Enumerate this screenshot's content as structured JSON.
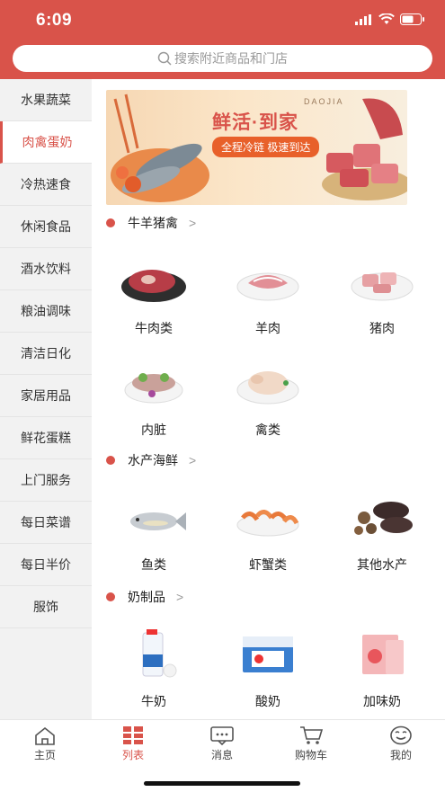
{
  "status": {
    "time": "6:09"
  },
  "search": {
    "placeholder": "搜索附近商品和门店"
  },
  "sidebar": {
    "items": [
      {
        "label": "水果蔬菜"
      },
      {
        "label": "肉禽蛋奶"
      },
      {
        "label": "冷热速食"
      },
      {
        "label": "休闲食品"
      },
      {
        "label": "酒水饮料"
      },
      {
        "label": "粮油调味"
      },
      {
        "label": "清洁日化"
      },
      {
        "label": "家居用品"
      },
      {
        "label": "鲜花蛋糕"
      },
      {
        "label": "上门服务"
      },
      {
        "label": "每日菜谱"
      },
      {
        "label": "每日半价"
      },
      {
        "label": "服饰"
      }
    ],
    "active_index": 1
  },
  "banner": {
    "title": "鲜活·到家",
    "subtitle": "DAOJIA",
    "pill": "全程冷链 极速到达"
  },
  "sections": [
    {
      "title": "牛羊猪禽",
      "arrow": ">",
      "items": [
        "牛肉类",
        "羊肉",
        "猪肉",
        "内脏",
        "禽类"
      ]
    },
    {
      "title": "水产海鲜",
      "arrow": ">",
      "items": [
        "鱼类",
        "虾蟹类",
        "其他水产"
      ]
    },
    {
      "title": "奶制品",
      "arrow": ">",
      "items": [
        "牛奶",
        "酸奶",
        "加味奶"
      ]
    }
  ],
  "tabbar": {
    "items": [
      {
        "label": "主页",
        "icon": "home-icon"
      },
      {
        "label": "列表",
        "icon": "grid-icon"
      },
      {
        "label": "消息",
        "icon": "message-icon"
      },
      {
        "label": "购物车",
        "icon": "cart-icon"
      },
      {
        "label": "我的",
        "icon": "smile-icon"
      }
    ],
    "active_index": 1
  },
  "colors": {
    "accent": "#d9534a",
    "background": "#f2f2f2"
  }
}
